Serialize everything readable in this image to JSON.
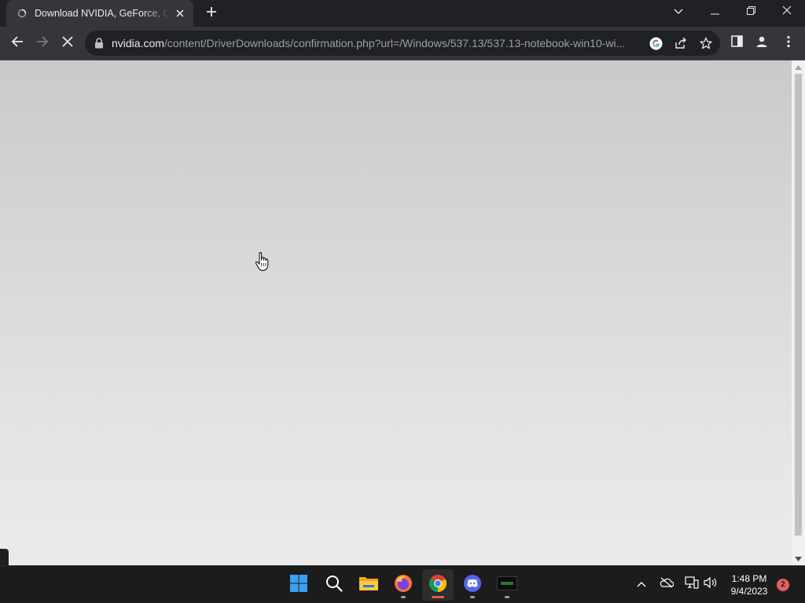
{
  "browser": {
    "tab": {
      "title": "Download NVIDIA, GeForce, Quadro",
      "favicon": "loading-globe-icon"
    },
    "new_tab_icon": "plus-icon",
    "window_controls": [
      "tab-search-icon",
      "minimize-icon",
      "restore-icon",
      "close-icon"
    ],
    "toolbar": {
      "back_icon": "arrow-left-icon",
      "forward_icon": "arrow-right-icon",
      "stop_icon": "x-icon",
      "url_host": "nvidia.com",
      "url_path": "/content/DriverDownloads/confirmation.php?url=/Windows/537.13/537.13-notebook-win10-wi...",
      "omnibox_icons": [
        "google-icon",
        "share-icon",
        "star-icon"
      ],
      "right_icons": [
        "side-panel-icon",
        "profile-icon",
        "more-vert-icon"
      ]
    }
  },
  "taskbar": {
    "apps": [
      {
        "name": "windows-start",
        "icon": "windows-logo-icon"
      },
      {
        "name": "search",
        "icon": "search-icon"
      },
      {
        "name": "file-explorer",
        "icon": "folder-icon"
      },
      {
        "name": "firefox",
        "icon": "firefox-icon"
      },
      {
        "name": "chrome",
        "icon": "chrome-icon",
        "active": true
      },
      {
        "name": "discord",
        "icon": "discord-icon"
      },
      {
        "name": "terminal",
        "icon": "terminal-icon"
      }
    ],
    "tray_icons": [
      "chevron-up-icon",
      "onedrive-offline-icon",
      "network-icon",
      "volume-icon"
    ],
    "clock": {
      "time": "1:48 PM",
      "date": "9/4/2023"
    },
    "notification_count": "2"
  },
  "colors": {
    "chrome_dark": "#202124",
    "toolbar": "#35363a",
    "taskbar": "#1c1c1c",
    "chrome_active_indicator": "#e85b4a"
  }
}
